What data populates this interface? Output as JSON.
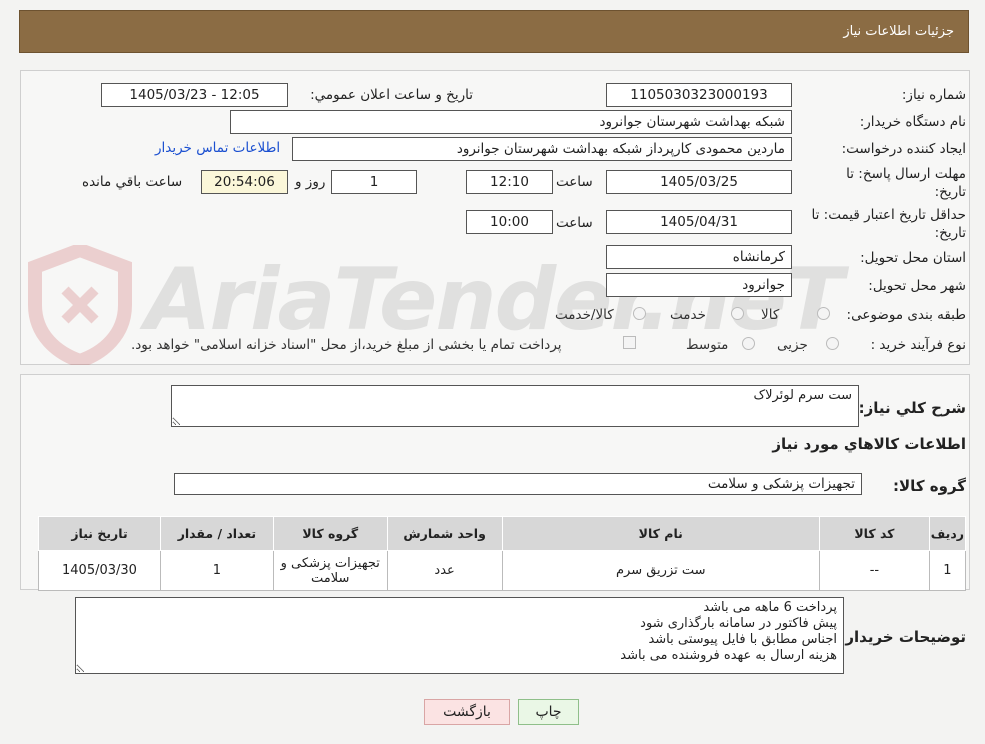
{
  "header": {
    "title": "جزئیات اطلاعات نیاز"
  },
  "fields": {
    "need_number_label": "شماره نیاز:",
    "need_number": "1105030323000193",
    "announce_label": "تاریخ و ساعت اعلان عمومي:",
    "announce_value": "1405/03/23 - 12:05",
    "buyer_org_label": "نام دستگاه خریدار:",
    "buyer_org": "شبکه بهداشت شهرستان جوانرود",
    "requester_label": "ایجاد کننده درخواست:",
    "requester": "ماردین محمودی کارپرداز شبکه بهداشت شهرستان جوانرود",
    "contact_link": "اطلاعات تماس خریدار",
    "deadline_label_1": "مهلت ارسال پاسخ: تا",
    "deadline_label_2": "تاریخ:",
    "deadline_date": "1405/03/25",
    "time_label": "ساعت",
    "deadline_time": "12:10",
    "days_value": "1",
    "days_label": "روز و",
    "remaining_time": "20:54:06",
    "remaining_label": "ساعت باقي مانده",
    "validity_label_1": "حداقل تاریخ اعتبار قیمت: تا",
    "validity_label_2": "تاریخ:",
    "validity_date": "1405/04/31",
    "validity_time": "10:00",
    "province_label": "استان محل تحویل:",
    "province": "کرمانشاه",
    "city_label": "شهر محل تحویل:",
    "city": "جوانرود",
    "category_label": "طبقه بندی موضوعی:",
    "category_options": [
      "کالا",
      "خدمت",
      "کالا/خدمت"
    ],
    "process_label": "نوع فرآیند خرید :",
    "process_options": [
      "جزیی",
      "متوسط"
    ],
    "payment_note": "پرداخت تمام یا بخشی از مبلغ خرید،از محل \"اسناد خزانه اسلامی\" خواهد بود."
  },
  "summary": {
    "general_desc_label": "شرح کلي نیاز:",
    "general_desc": "ست سرم لوئرلاک",
    "goods_info_title": "اطلاعات کالاهاي مورد نیاز",
    "goods_group_label": "گروه کالا:",
    "goods_group": "تجهیزات پزشکی و سلامت"
  },
  "table": {
    "headers": [
      "ردیف",
      "کد کالا",
      "نام کالا",
      "واحد شمارش",
      "گروه کالا",
      "تعداد / مقدار",
      "تاریخ نیاز"
    ],
    "rows": [
      [
        "1",
        "--",
        "ست تزریق سرم",
        "عدد",
        "تجهیزات پزشکی و سلامت",
        "1",
        "1405/03/30"
      ]
    ]
  },
  "buyer_notes": {
    "label": "توضیحات خریدار:",
    "text": "پرداخت 6 ماهه می باشد\nپیش فاکتور در سامانه بارگذاری شود\nاجناس مطابق با فایل پیوستی باشد\nهزینه ارسال به عهده فروشنده می باشد"
  },
  "buttons": {
    "print": "چاپ",
    "back": "بازگشت"
  },
  "watermark": {
    "text": "AriaTender.neT",
    "icon": "shield-logo-icon"
  },
  "colors": {
    "header_bg": "#8b6c44",
    "link": "#1a4fd0",
    "print_button_bg": "#eaf7e6",
    "back_button_bg": "#fbe3e3"
  }
}
